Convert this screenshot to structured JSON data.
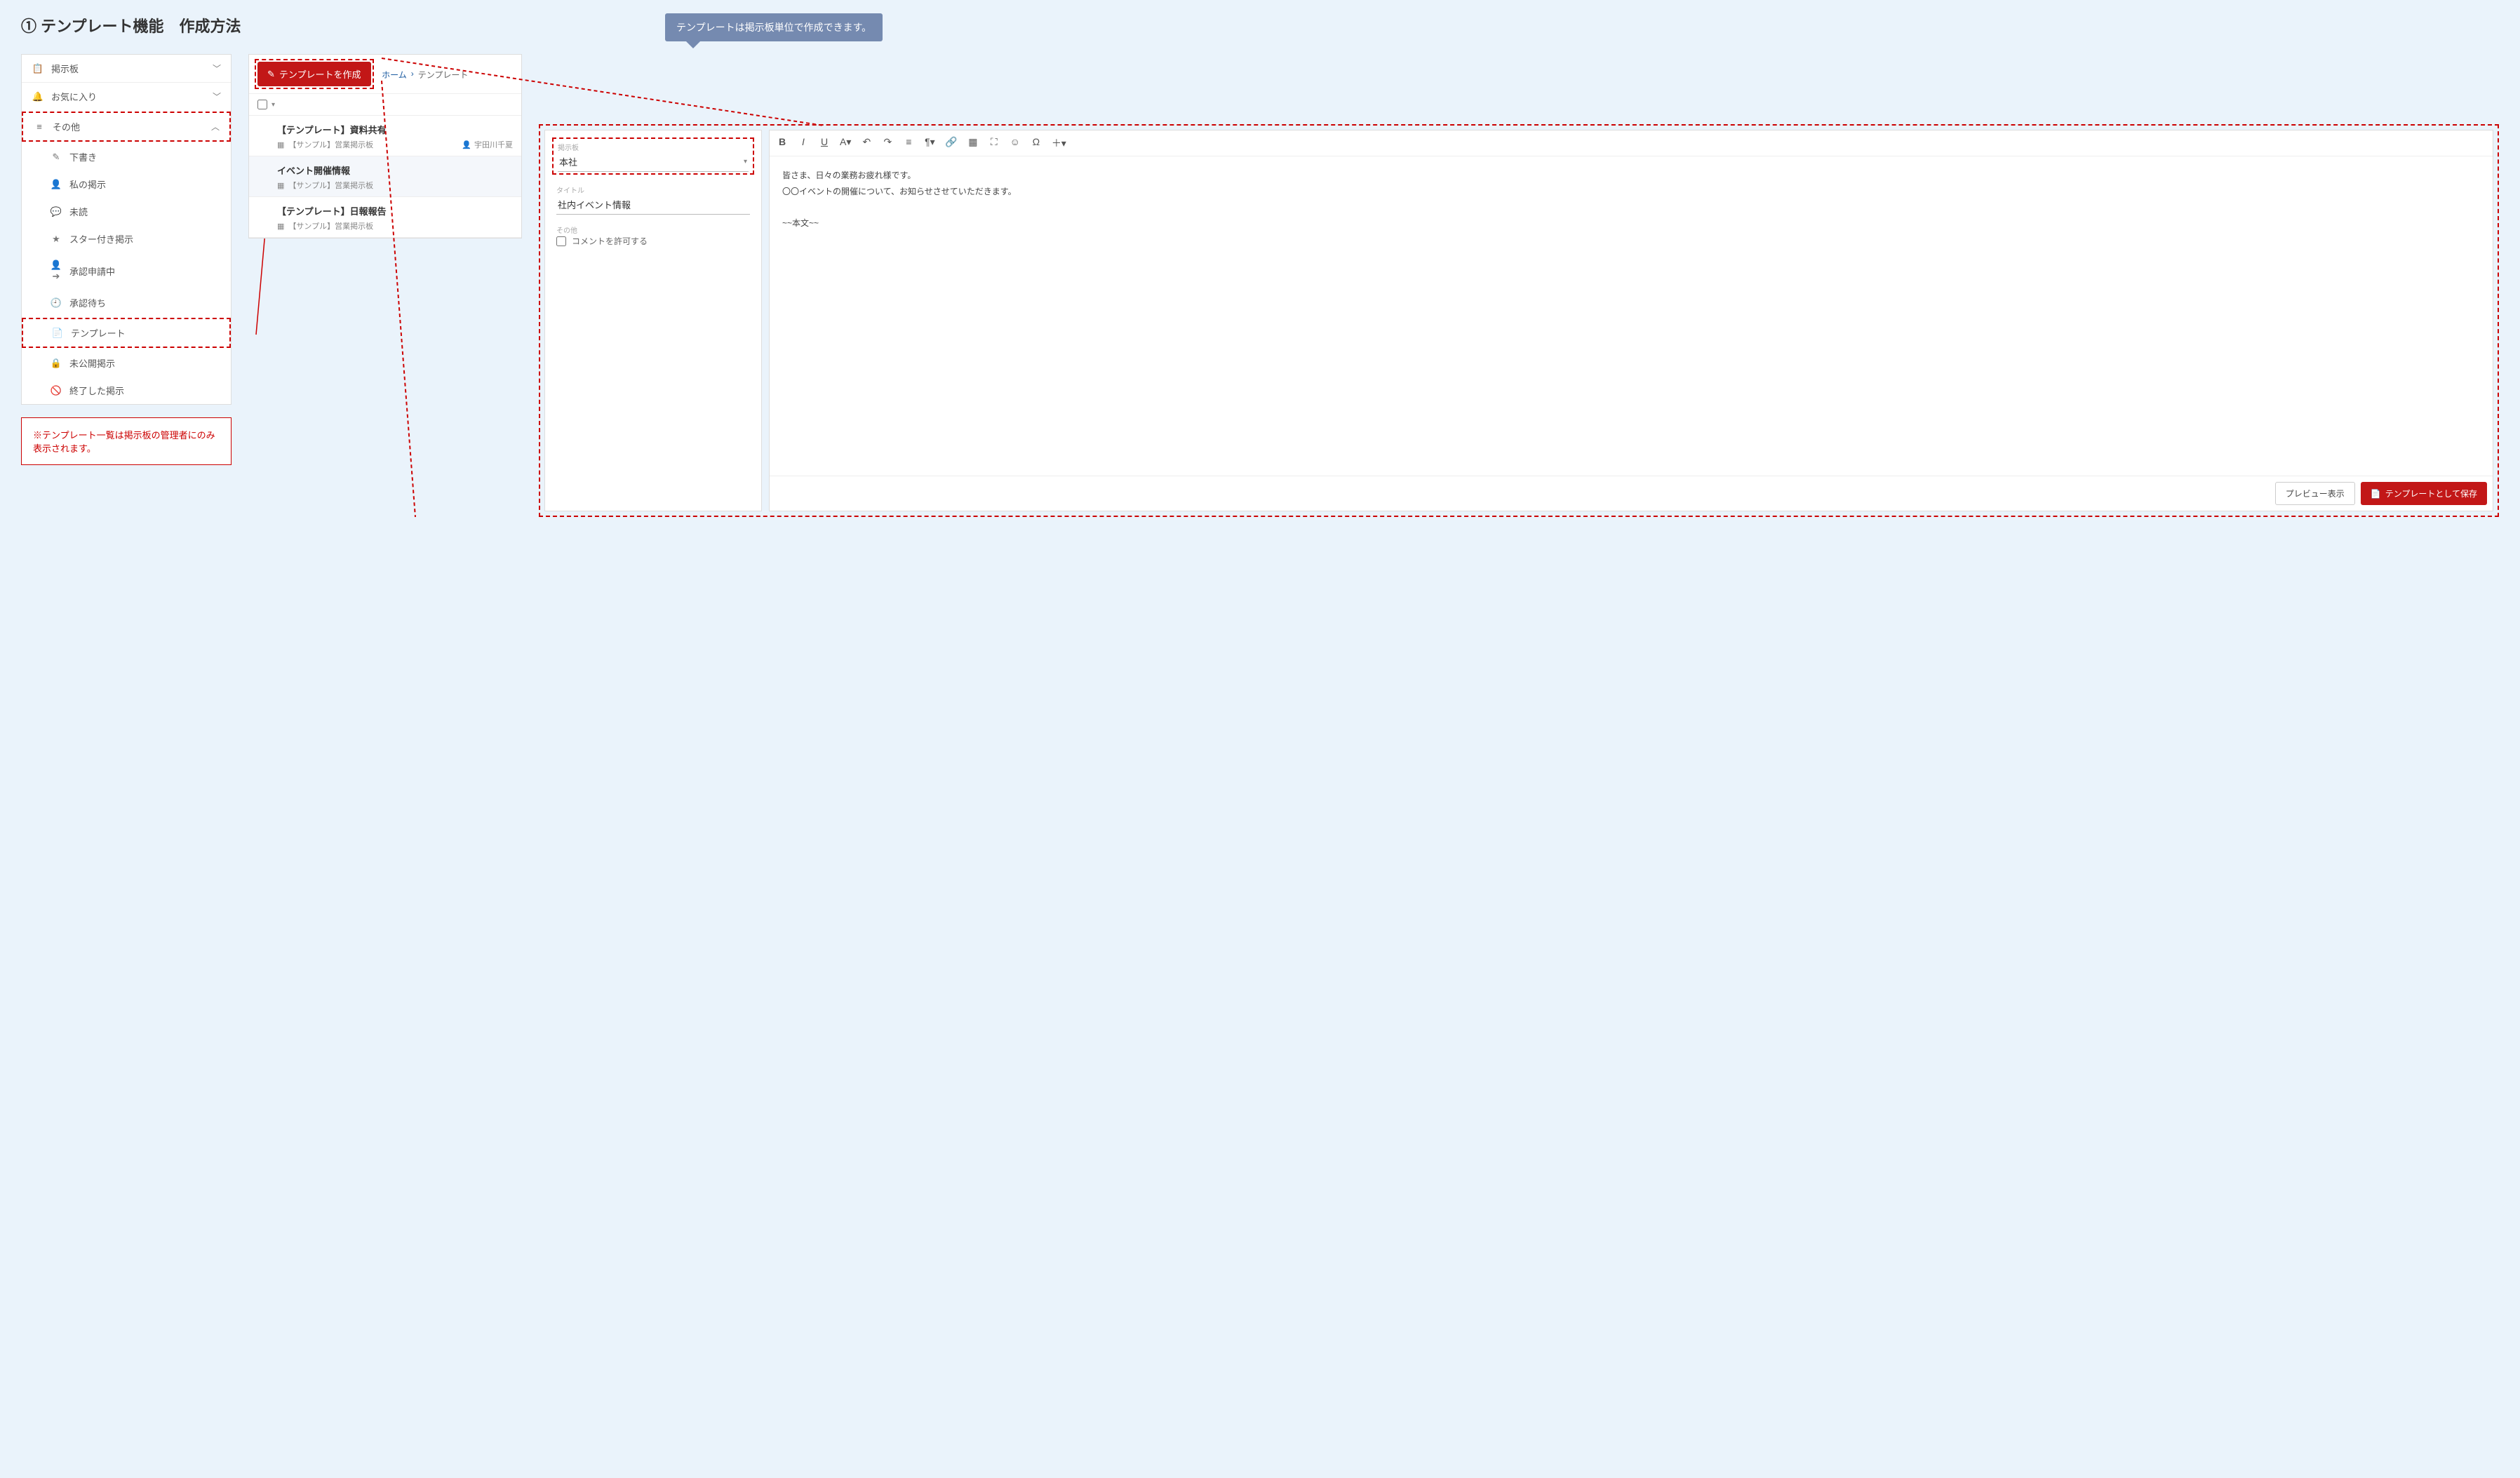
{
  "page_title": "① テンプレート機能　作成方法",
  "sidebar": {
    "board_label": "掲示板",
    "fav_label": "お気に入り",
    "other_label": "その他",
    "items": {
      "draft": "下書き",
      "mine": "私の掲示",
      "unread": "未読",
      "starred": "スター付き掲示",
      "approval_req": "承認申請中",
      "approval_wait": "承認待ち",
      "template": "テンプレート",
      "unpublished": "未公開掲示",
      "finished": "終了した掲示"
    }
  },
  "note": "※テンプレート一覧は掲示板の管理者にのみ表示されます。",
  "center": {
    "create_btn": "テンプレートを作成",
    "breadcrumb_home": "ホーム",
    "breadcrumb_sep": "›",
    "breadcrumb_current": "テンプレート",
    "rows": [
      {
        "title": "【テンプレート】資料共有",
        "board": "【サンプル】営業掲示板",
        "author": "宇田川千夏"
      },
      {
        "title": "イベント開催情報",
        "board": "【サンプル】営業掲示板",
        "author": ""
      },
      {
        "title": "【テンプレート】日報報告",
        "board": "【サンプル】営業掲示板",
        "author": ""
      }
    ]
  },
  "callout": "テンプレートは掲示板単位で作成できます。",
  "editor": {
    "board_label": "掲示板",
    "board_value": "本社",
    "title_label": "タイトル",
    "title_value": "社内イベント情報",
    "other_label": "その他",
    "allow_comment": "コメントを許可する",
    "body_line1": "皆さま、日々の業務お疲れ様です。",
    "body_line2": "〇〇イベントの開催について、お知らせさせていただきます。",
    "body_line3": "~~本文~~",
    "preview_btn": "プレビュー表示",
    "save_btn": "テンプレートとして保存"
  }
}
